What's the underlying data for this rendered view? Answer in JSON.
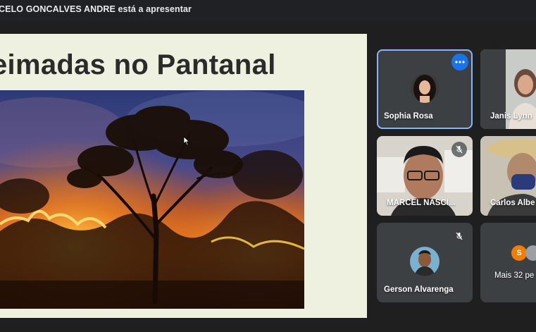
{
  "presenter": {
    "text": "CELO GONCALVES ANDRE está a apresentar"
  },
  "slide": {
    "title": "eimadas no Pantanal"
  },
  "participants": [
    {
      "name": "Sophia Rosa"
    },
    {
      "name": "Janis Lynn"
    },
    {
      "name": "MARCEL NASCI..."
    },
    {
      "name": "Carlos Albe"
    },
    {
      "name": "Gerson Alvarenga"
    },
    {
      "name": "Mais 32 pe"
    }
  ],
  "others": {
    "initial": "S"
  },
  "colors": {
    "accent": "#8ab4f8",
    "menu": "#1a73e8",
    "tile": "#3c4043",
    "avatar_orange": "#f57c00"
  }
}
